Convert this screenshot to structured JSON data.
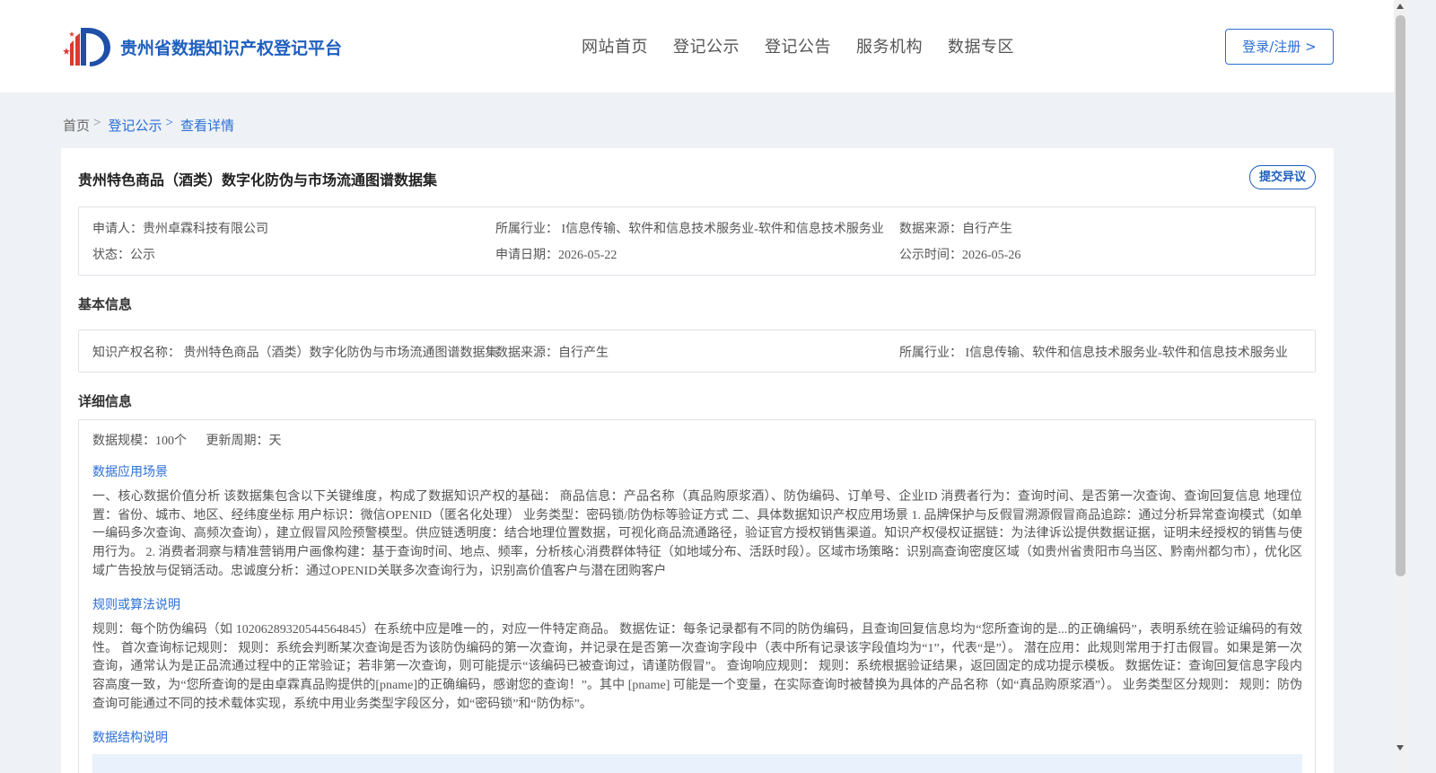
{
  "header": {
    "logo_text": "贵州省数据知识产权登记平台",
    "nav": [
      "网站首页",
      "登记公示",
      "登记公告",
      "服务机构",
      "数据专区"
    ],
    "login_label": "登录/注册 >"
  },
  "breadcrumb": {
    "home": "首页",
    "sep": ">",
    "items": [
      "登记公示",
      "查看详情"
    ]
  },
  "detail": {
    "title": "贵州特色商品（酒类）数字化防伪与市场流通图谱数据集",
    "objection_label": "提交异议",
    "meta": {
      "applicant": "申请人：贵州卓霖科技有限公司",
      "industry": "所属行业： I信息传输、软件和信息技术服务业-软件和信息技术服务业",
      "source": "数据来源：自行产生",
      "status": "状态：公示",
      "apply_date": "申请日期：2026-05-22",
      "publish_time": "公示时间：2026-05-26"
    },
    "basic_title": "基本信息",
    "basic": {
      "ip_name": "知识产权名称： 贵州特色商品（酒类）数字化防伪与市场流通图谱数据集",
      "source": "数据来源：自行产生",
      "industry": "所属行业： I信息传输、软件和信息技术服务业-软件和信息技术服务业"
    },
    "detail_title": "详细信息",
    "scale": "数据规模：100个",
    "cycle": "更新周期：天",
    "scenario_title": "数据应用场景",
    "scenario_text": "一、核心数据价值分析 该数据集包含以下关键维度，构成了数据知识产权的基础： 商品信息：产品名称（真品购原浆酒）、防伪编码、订单号、企业ID 消费者行为：查询时间、是否第一次查询、查询回复信息 地理位置：省份、城市、地区、经纬度坐标 用户标识：微信OPENID（匿名化处理） 业务类型：密码锁/防伪标等验证方式 二、具体数据知识产权应用场景 1. 品牌保护与反假冒溯源假冒商品追踪：通过分析异常查询模式（如单一编码多次查询、高频次查询），建立假冒风险预警模型。供应链透明度：结合地理位置数据，可视化商品流通路径，验证官方授权销售渠道。知识产权侵权证据链：为法律诉讼提供数据证据，证明未经授权的销售与使用行为。 2. 消费者洞察与精准营销用户画像构建：基于查询时间、地点、频率，分析核心消费群体特征（如地域分布、活跃时段）。区域市场策略：识别高查询密度区域（如贵州省贵阳市乌当区、黔南州都匀市），优化区域广告投放与促销活动。忠诚度分析：通过OPENID关联多次查询行为，识别高价值客户与潜在团购客户",
    "rules_title": "规则或算法说明",
    "rules_text": "规则：每个防伪编码（如 10206289320544564845）在系统中应是唯一的，对应一件特定商品。 数据佐证：每条记录都有不同的防伪编码，且查询回复信息均为“您所查询的是...的正确编码”，表明系统在验证编码的有效性。 首次查询标记规则： 规则：系统会判断某次查询是否为该防伪编码的第一次查询，并记录在是否第一次查询字段中（表中所有记录该字段值均为“1”，代表“是”）。 潜在应用：此规则常用于打击假冒。如果是第一次查询，通常认为是正品流通过程中的正常验证；若非第一次查询，则可能提示“该编码已被查询过，请谨防假冒”。 查询响应规则： 规则：系统根据验证结果，返回固定的成功提示模板。 数据佐证：查询回复信息字段内容高度一致，为“您所查询的是由卓霖真品购提供的[pname]的正确编码，感谢您的查询！”。其中 [pname] 可能是一个变量，在实际查询时被替换为具体的产品名称（如“真品购原浆酒”）。 业务类型区分规则： 规则：防伪查询可能通过不同的技术载体实现，系统中用业务类型字段区分，如“密码锁”和“防伪标”。",
    "structure_title": "数据结构说明"
  }
}
